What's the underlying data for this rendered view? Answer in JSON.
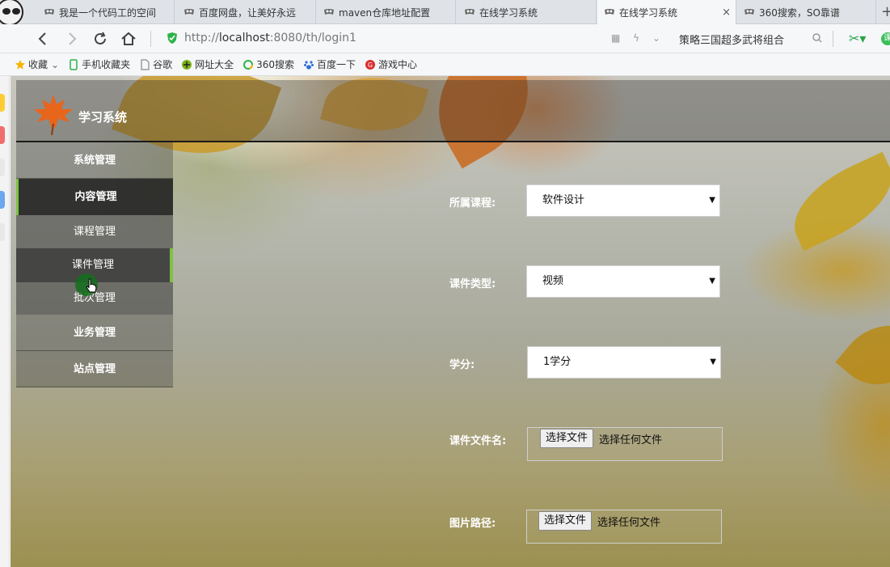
{
  "browser": {
    "tabs": [
      {
        "label": "我是一个代码工的空间",
        "active": false
      },
      {
        "label": "百度网盘，让美好永远",
        "active": false
      },
      {
        "label": "maven仓库地址配置",
        "active": false
      },
      {
        "label": "在线学习系统",
        "active": false
      },
      {
        "label": "在线学习系统",
        "active": true
      },
      {
        "label": "360搜索，SO靠谱",
        "active": false
      }
    ],
    "close_glyph": "×",
    "new_tab_glyph": "+",
    "address": {
      "prefix": "http://",
      "host": "localhost",
      "rest": ":8080/th/login1"
    },
    "search_text": "策略三国超多武将组合",
    "bookmarks": [
      {
        "label": "收藏",
        "icon": "star-icon"
      },
      {
        "label": "手机收藏夹",
        "icon": "phone-icon"
      },
      {
        "label": "谷歌",
        "icon": "page-icon"
      },
      {
        "label": "网址大全",
        "icon": "globe-icon"
      },
      {
        "label": "360搜索",
        "icon": "search360-icon"
      },
      {
        "label": "百度一下",
        "icon": "paw-icon"
      },
      {
        "label": "游戏中心",
        "icon": "game-icon"
      }
    ],
    "green_badge": "课"
  },
  "app": {
    "brand": "学习系统",
    "menu": [
      {
        "label": "系统管理",
        "kind": "main"
      },
      {
        "label": "内容管理",
        "kind": "open"
      },
      {
        "label": "课程管理",
        "kind": "sub"
      },
      {
        "label": "课件管理",
        "kind": "sub-active"
      },
      {
        "label": "批次管理",
        "kind": "sub"
      },
      {
        "label": "业务管理",
        "kind": "main"
      },
      {
        "label": "站点管理",
        "kind": "main"
      }
    ],
    "form": {
      "course_label": "所属课程:",
      "course_value": "软件设计",
      "type_label": "课件类型:",
      "type_value": "视频",
      "credit_label": "学分:",
      "credit_value": "1学分",
      "filename_label": "课件文件名:",
      "image_label": "图片路径:",
      "file_button": "选择文件",
      "file_status": "选择任何文件"
    }
  },
  "colors": {
    "accent": "#7dc242",
    "menu_dark": "#1e1e1e"
  }
}
